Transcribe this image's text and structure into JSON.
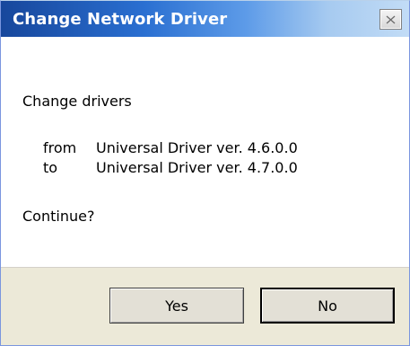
{
  "window": {
    "title": "Change Network Driver",
    "close_icon": "close-icon"
  },
  "message": {
    "heading": "Change drivers",
    "from_label": "from",
    "from_value": "Universal Driver ver. 4.6.0.0",
    "to_label": "to",
    "to_value": "Universal Driver ver. 4.7.0.0",
    "question": "Continue?"
  },
  "buttons": {
    "yes_label": "Yes",
    "no_label": "No"
  },
  "colors": {
    "titlebar_start": "#17479c",
    "titlebar_end": "#c2dcf6",
    "footer_bg": "#ece9d8",
    "content_bg": "#ffffff"
  }
}
